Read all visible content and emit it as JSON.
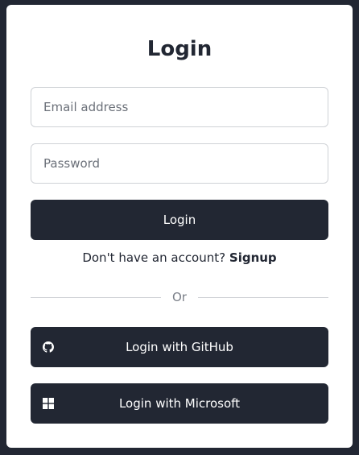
{
  "card": {
    "title": "Login"
  },
  "form": {
    "email_placeholder": "Email address",
    "password_placeholder": "Password",
    "login_label": "Login"
  },
  "signup": {
    "prompt": "Don't have an account?",
    "link_label": "Signup"
  },
  "divider": {
    "label": "Or"
  },
  "oauth": {
    "github_label": "Login with GitHub",
    "github_icon": "github-icon",
    "microsoft_label": "Login with Microsoft",
    "microsoft_icon": "windows-icon"
  },
  "colors": {
    "background": "#222733",
    "card": "#ffffff",
    "button": "#222733",
    "border": "#cfd2d6"
  }
}
